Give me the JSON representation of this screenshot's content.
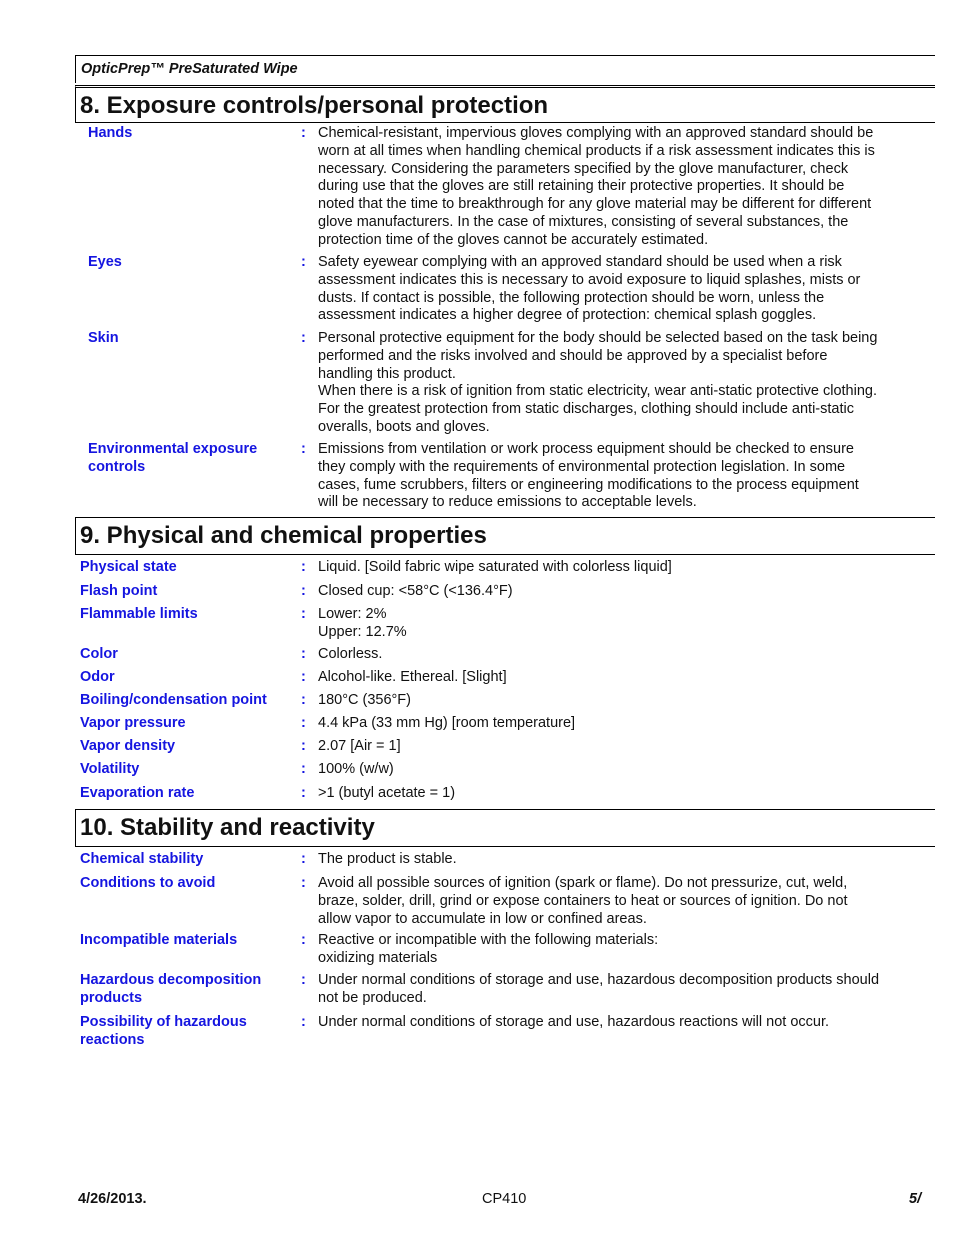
{
  "header": {
    "product_name": "OpticPrep™ PreSaturated Wipe"
  },
  "sections": [
    {
      "title": "8. Exposure controls/personal protection",
      "rows": [
        {
          "label": "Hands",
          "value": "Chemical-resistant, impervious gloves complying with an approved standard should be\nworn at all times when handling chemical products if a risk assessment indicates this is\nnecessary.  Considering the parameters specified by the glove manufacturer, check\nduring use that the gloves are still retaining their protective properties.  It should be\nnoted that the time to breakthrough for any glove material may be different for different\nglove manufacturers.  In the case of mixtures, consisting of several substances, the\nprotection time of the gloves cannot be accurately estimated."
        },
        {
          "label": "Eyes",
          "value": "Safety eyewear complying with an approved standard should be used when a risk\nassessment indicates this is necessary to avoid exposure to liquid splashes, mists or\ndusts.  If contact is possible, the following protection should be worn, unless the\nassessment indicates a higher degree of protection:  chemical splash goggles."
        },
        {
          "label": "Skin",
          "value": "Personal protective equipment for the body should be selected based on the task being\nperformed and the risks involved and should be approved by a specialist before\nhandling this product.\nWhen there is a risk of ignition from static electricity, wear anti-static protective clothing.\nFor the greatest protection from static discharges, clothing should include anti-static\noveralls, boots and gloves."
        },
        {
          "label": "Environmental exposure\ncontrols",
          "value": "Emissions from ventilation or work process equipment should be checked to ensure\nthey comply with the requirements of environmental protection legislation.  In some\ncases, fume scrubbers, filters or engineering modifications to the process equipment\nwill be necessary to reduce emissions to acceptable levels."
        }
      ]
    },
    {
      "title": "9. Physical and chemical properties",
      "rows": [
        {
          "label": "Physical state",
          "value": "Liquid. [Soild fabric wipe saturated with colorless liquid]"
        },
        {
          "label": "Flash point",
          "value": "Closed cup: <58°C (<136.4°F)"
        },
        {
          "label": "Flammable limits",
          "value": "Lower: 2%\nUpper: 12.7%"
        },
        {
          "label": "Color",
          "value": "Colorless."
        },
        {
          "label": "Odor",
          "value": "Alcohol-like. Ethereal. [Slight]"
        },
        {
          "label": "Boiling/condensation point",
          "value": "180°C (356°F)"
        },
        {
          "label": "Vapor pressure",
          "value": "4.4 kPa (33 mm Hg) [room temperature]"
        },
        {
          "label": "Vapor density",
          "value": "2.07 [Air = 1]"
        },
        {
          "label": "Volatility",
          "value": "100% (w/w)"
        },
        {
          "label": "Evaporation rate",
          "value": ">1 (butyl acetate = 1)"
        }
      ]
    },
    {
      "title": "10. Stability and reactivity",
      "rows": [
        {
          "label": "Chemical stability",
          "value": "The product is stable."
        },
        {
          "label": "Conditions to avoid",
          "value": "Avoid all possible sources of ignition (spark or flame).  Do not pressurize, cut, weld,\nbraze, solder, drill, grind or expose containers to heat or sources of ignition.  Do not\nallow vapor to accumulate in low or confined areas."
        },
        {
          "label": "Incompatible materials",
          "value": "Reactive or incompatible with the following materials:\noxidizing materials"
        },
        {
          "label": "Hazardous decomposition\nproducts",
          "value": "Under normal conditions of storage and use, hazardous decomposition products should\nnot be produced."
        },
        {
          "label": "Possibility of hazardous\nreactions",
          "value": "Under normal conditions of storage and use, hazardous reactions will not occur."
        }
      ]
    }
  ],
  "colon": ":",
  "footer": {
    "date": "4/26/2013.",
    "code": "CP410",
    "page": "5/"
  }
}
